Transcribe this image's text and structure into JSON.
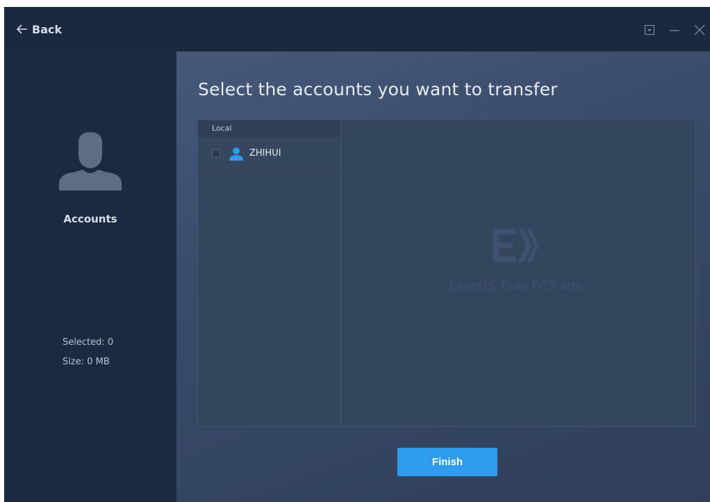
{
  "titlebar": {
    "back_label": "Back",
    "controls": [
      "dropdown-menu-icon",
      "minimize-icon",
      "close-icon"
    ]
  },
  "sidebar": {
    "icon": "user-silhouette-icon",
    "title": "Accounts",
    "selected_label": "Selected:",
    "selected_value": "0",
    "size_label": "Size:",
    "size_value": "0 MB"
  },
  "main": {
    "heading": "Select the accounts you want to transfer",
    "list_header": "Local",
    "accounts": [
      {
        "name": "ZHIHUI",
        "checked": false,
        "icon": "user-icon"
      }
    ],
    "watermark": "EaseUS Todo PCTrans",
    "finish_label": "Finish"
  },
  "colors": {
    "accent": "#2e9bee",
    "sidebar_bg": "#1b2a41",
    "panel_bg": "#35465f"
  }
}
